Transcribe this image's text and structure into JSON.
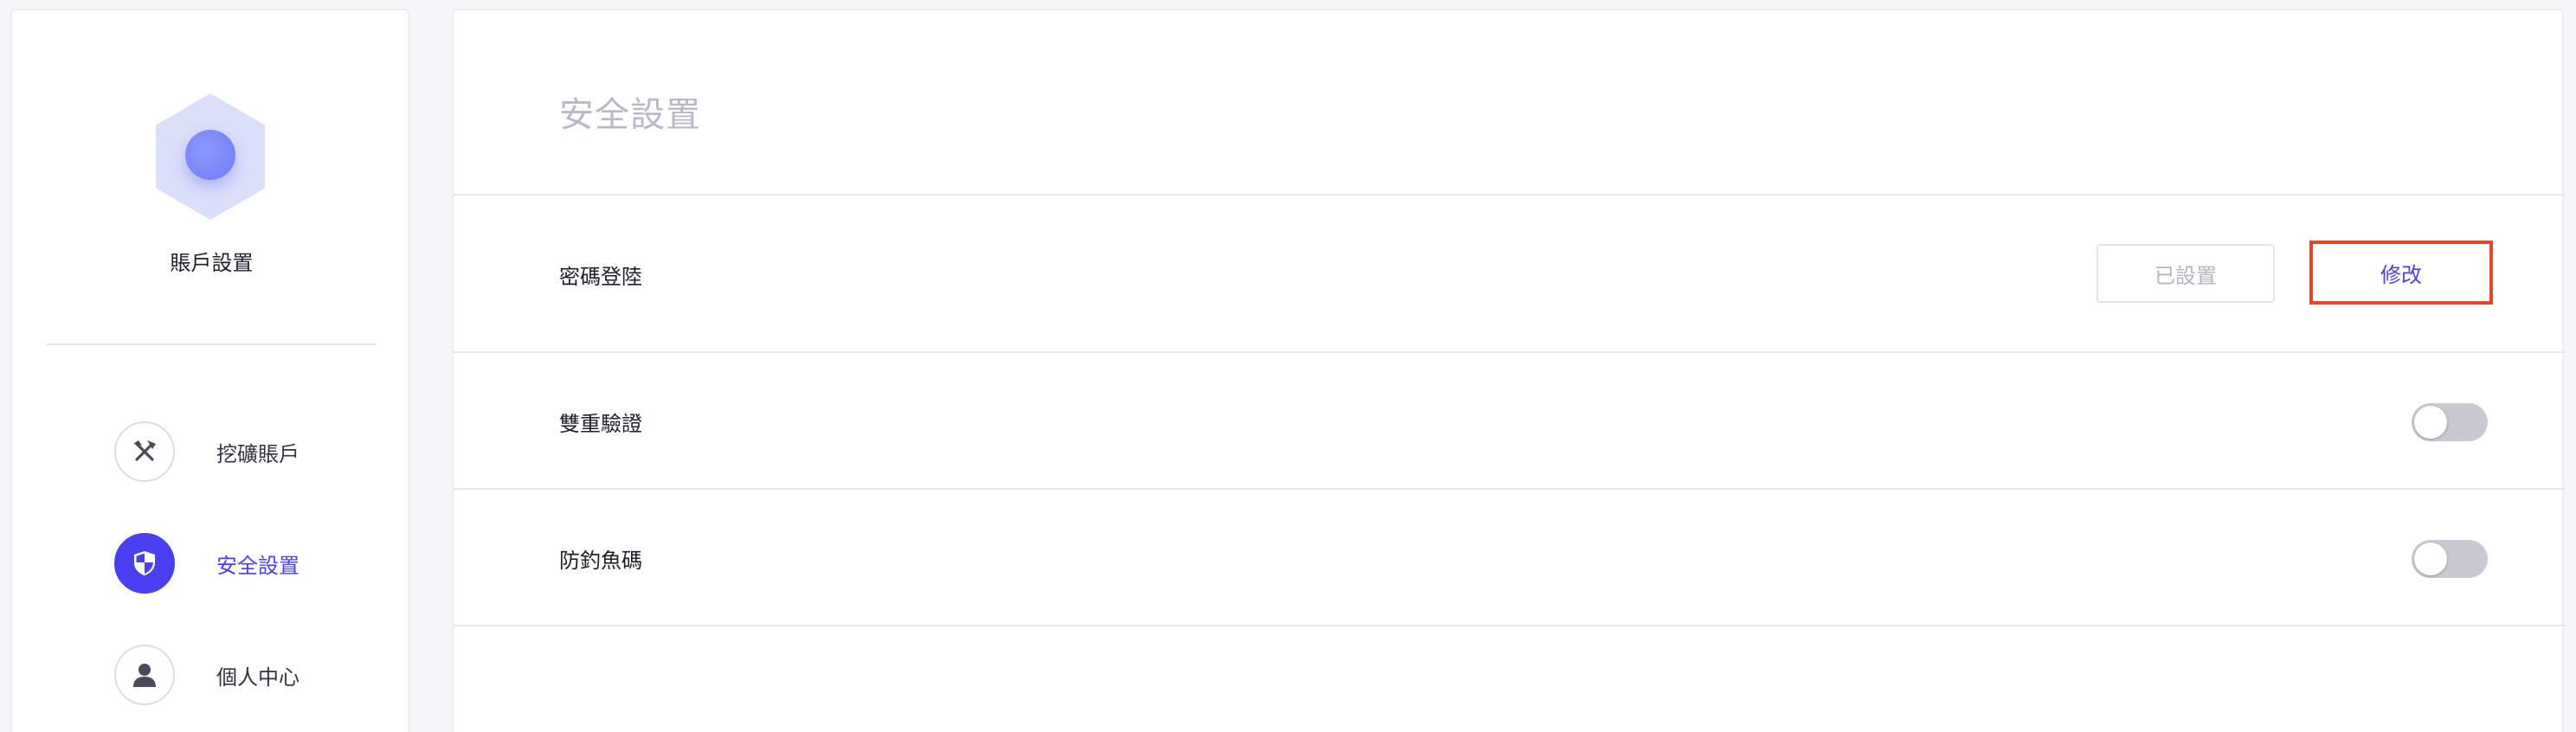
{
  "sidebar": {
    "account_title": "賬戶設置",
    "items": [
      {
        "label": "挖礦賬戶",
        "icon": "pickaxe-hammer-icon",
        "active": false
      },
      {
        "label": "安全設置",
        "icon": "shield-icon",
        "active": true
      },
      {
        "label": "個人中心",
        "icon": "user-icon",
        "active": false
      }
    ]
  },
  "main": {
    "title": "安全設置",
    "rows": [
      {
        "label": "密碼登陸",
        "status_label": "已設置",
        "action_label": "修改"
      },
      {
        "label": "雙重驗證",
        "toggle_on": false
      },
      {
        "label": "防釣魚碼",
        "toggle_on": false
      }
    ]
  },
  "colors": {
    "accent": "#4a3ff0",
    "highlight_border": "#e4452b",
    "toggle_off": "#c9c9d2",
    "title_muted": "#b7b9c9"
  }
}
